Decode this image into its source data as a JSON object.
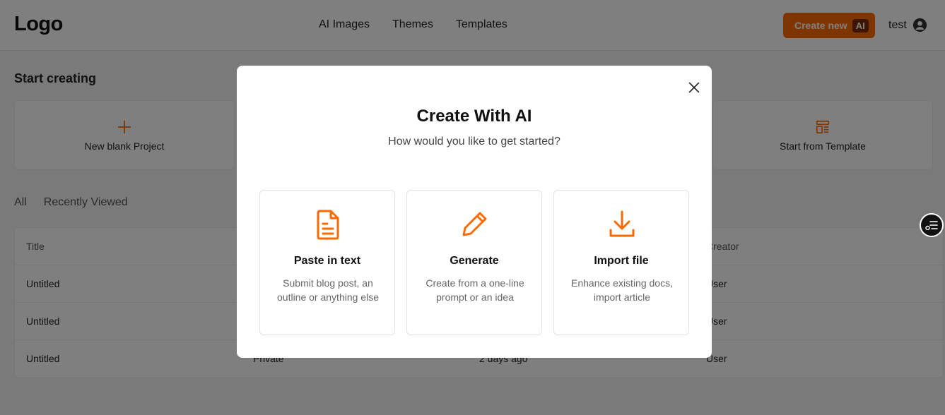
{
  "header": {
    "logo": "Logo",
    "nav": [
      "AI Images",
      "Themes",
      "Templates"
    ],
    "create_button": "Create new",
    "ai_badge": "AI",
    "user_name": "test"
  },
  "main": {
    "section_title": "Start creating",
    "cards": [
      {
        "label": "New blank Project",
        "icon": "plus-icon"
      },
      {
        "label": "Start from Template",
        "icon": "template-icon"
      }
    ],
    "filters": [
      "All",
      "Recently Viewed"
    ],
    "table": {
      "columns": [
        "Title",
        "",
        "",
        "Creator"
      ],
      "rows": [
        {
          "title": "Untitled",
          "visibility": "",
          "modified": "",
          "creator": "User"
        },
        {
          "title": "Untitled",
          "visibility": "",
          "modified": "",
          "creator": "User"
        },
        {
          "title": "Untitled",
          "visibility": "Private",
          "modified": "2 days ago",
          "creator": "User"
        }
      ]
    }
  },
  "modal": {
    "title": "Create With AI",
    "subtitle": "How would you like to get started?",
    "options": [
      {
        "title": "Paste in text",
        "desc": "Submit blog post, an outline or anything else",
        "icon": "document-icon"
      },
      {
        "title": "Generate",
        "desc": "Create from a one-line prompt or an idea",
        "icon": "pencil-icon"
      },
      {
        "title": "Import file",
        "desc": "Enhance existing docs, import article",
        "icon": "download-icon"
      }
    ]
  },
  "colors": {
    "accent": "#ff6a00",
    "overlay": "rgba(0,0,0,0.5)"
  }
}
